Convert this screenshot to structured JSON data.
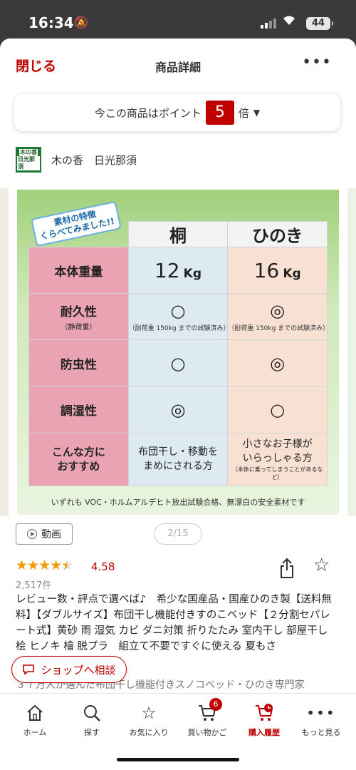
{
  "status_bar": {
    "time": "16:34",
    "battery": "44"
  },
  "header": {
    "close_label": "閉じる",
    "title": "商品詳細",
    "more_label": "•••"
  },
  "points": {
    "prefix": "今この商品はポイント",
    "multiplier": "5",
    "suffix": "倍"
  },
  "shop": {
    "logo_text": [
      "木の香",
      "日光那須"
    ],
    "name": "木の香　日光那須"
  },
  "image": {
    "tag": [
      "素材の特徴",
      "くらべてみました!!"
    ],
    "columns": [
      "桐",
      "ひのき"
    ],
    "rows": [
      {
        "label": "本体重量",
        "sub": "",
        "kiri": "12",
        "hino": "16",
        "unit": "Kg"
      },
      {
        "label": "耐久性",
        "sub": "（静荷重）",
        "kiri": "○",
        "hino": "◎",
        "kiri_note": "（耐荷重 150kg までの試験済み）",
        "hino_note": "（耐荷重 150kg までの試験済み）"
      },
      {
        "label": "防虫性",
        "kiri": "○",
        "hino": "◎"
      },
      {
        "label": "調湿性",
        "kiri": "◎",
        "hino": "○"
      },
      {
        "label": "こんな方に\nおすすめ",
        "kiri": "布団干し・移動を\nまめにされる方",
        "hino": "小さなお子様が\nいらっしゃる方",
        "hino_note": "（本体に乗ってしまうことがあるなど）"
      }
    ],
    "footnote": "いずれも VOC・ホルムアルデヒト放出試験合格、無漂白の安全素材です"
  },
  "media": {
    "video_label": "動画",
    "pager": "2/15"
  },
  "rating": {
    "score": "4.58",
    "stars": 4.5,
    "reviews": "2,517件"
  },
  "description": "レビュー数・評点で選べば♪　希少な国産品・国産ひのき製【送料無料】【ダブルサイズ】布団干し機能付きすのこベッド【２分割セパレート式】黄砂 雨 湿気 カビ ダニ対策 折りたたみ 室内干し 部屋干し 桧 ヒノキ 檜 脱プラ　組立て不要ですぐに使える 夏もさ",
  "sub_description": "３７万人が選んだ布団干し機能付きスノコベッド・ひのき専門家",
  "consult_label": "ショップへ相談",
  "nav": [
    {
      "label": "ホーム",
      "icon": "home-icon"
    },
    {
      "label": "探す",
      "icon": "search-icon"
    },
    {
      "label": "お気に入り",
      "icon": "star-icon"
    },
    {
      "label": "買い物かご",
      "icon": "cart-icon",
      "badge": "6"
    },
    {
      "label": "購入履歴",
      "icon": "history-icon",
      "active": true
    },
    {
      "label": "もっと見る",
      "icon": "more-icon"
    }
  ],
  "colors": {
    "brand": "#bf0000",
    "rating": "#f29a00"
  }
}
